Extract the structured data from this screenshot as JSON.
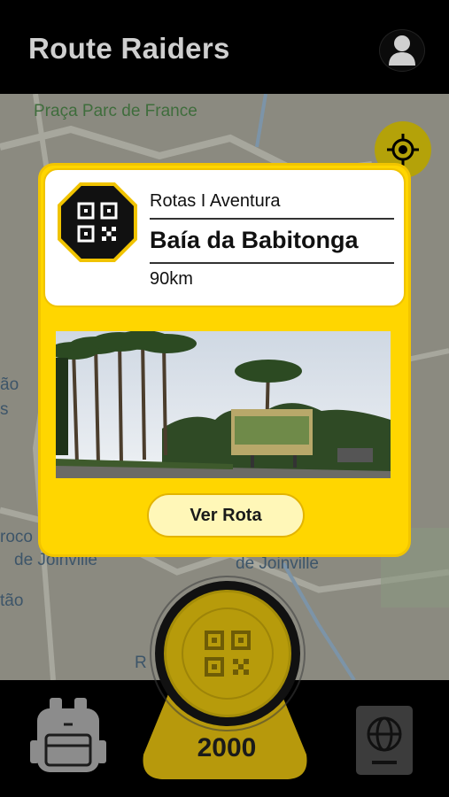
{
  "header": {
    "title": "Route Raiders",
    "profile_icon": "user-icon"
  },
  "map": {
    "labels": [
      "Praça Parc de France",
      "ão",
      "s",
      "roco",
      "de Joinville",
      "de Joinville",
      "tão",
      "R"
    ],
    "locate_icon": "crosshair-icon"
  },
  "route_card": {
    "badge_icon": "qr-code-icon",
    "category": "Rotas I Aventura",
    "name": "Baía da Babitonga",
    "distance": "90km",
    "photo_icon": "route-photo",
    "button_label": "Ver Rota"
  },
  "bottom_bar": {
    "backpack_icon": "backpack-icon",
    "scan_icon": "qr-code-icon",
    "score": "2000",
    "passport_icon": "passport-icon"
  },
  "colors": {
    "accent": "#ffd600",
    "header_bg": "#000000",
    "title_text": "#cfcfcf"
  }
}
